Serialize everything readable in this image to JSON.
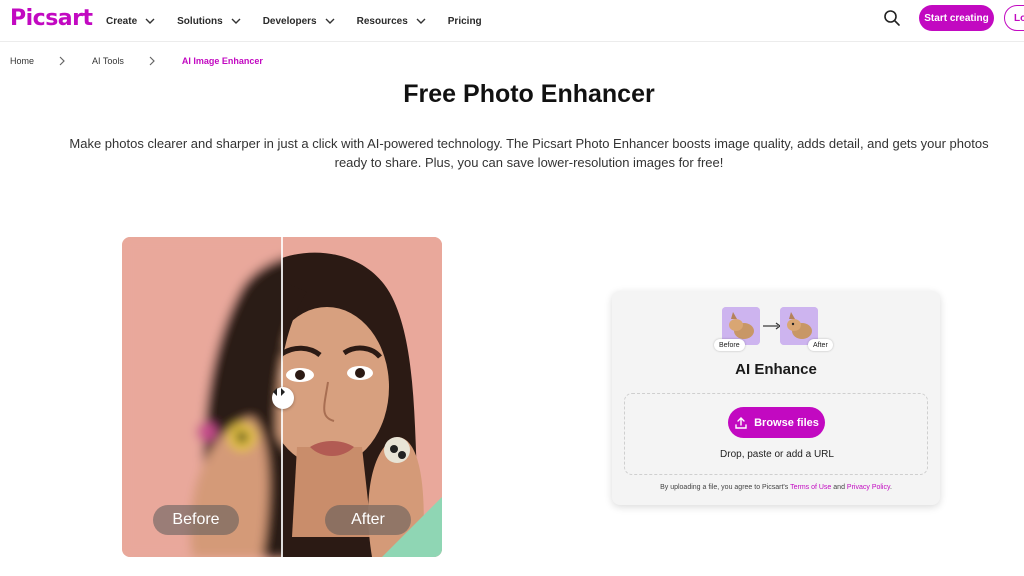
{
  "brand": {
    "logo_text": "Picsart",
    "accent": "#c209c1"
  },
  "nav": {
    "items": [
      {
        "label": "Create",
        "has_dropdown": true
      },
      {
        "label": "Solutions",
        "has_dropdown": true
      },
      {
        "label": "Developers",
        "has_dropdown": true
      },
      {
        "label": "Resources",
        "has_dropdown": true
      },
      {
        "label": "Pricing",
        "has_dropdown": false
      }
    ],
    "start_label": "Start creating",
    "login_label": "Lo"
  },
  "breadcrumb": {
    "items": [
      "Home",
      "AI Tools",
      "AI Image Enhancer"
    ]
  },
  "hero": {
    "title": "Free Photo Enhancer",
    "description": "Make photos clearer and sharper in just a click with AI-powered technology. The Picsart Photo Enhancer boosts image quality, adds detail, and gets your photos ready to share. Plus, you can save lower-resolution images for free!"
  },
  "compare": {
    "before_label": "Before",
    "after_label": "After"
  },
  "upload": {
    "thumb_before": "Before",
    "thumb_after": "After",
    "title": "AI Enhance",
    "browse_label": "Browse files",
    "drop_text": "Drop, paste or add a URL",
    "legal_prefix": "By uploading a file, you agree to Picsart's",
    "terms_label": "Terms of Use",
    "and_text": "and",
    "privacy_label": "Privacy Policy",
    "legal_suffix": "."
  }
}
